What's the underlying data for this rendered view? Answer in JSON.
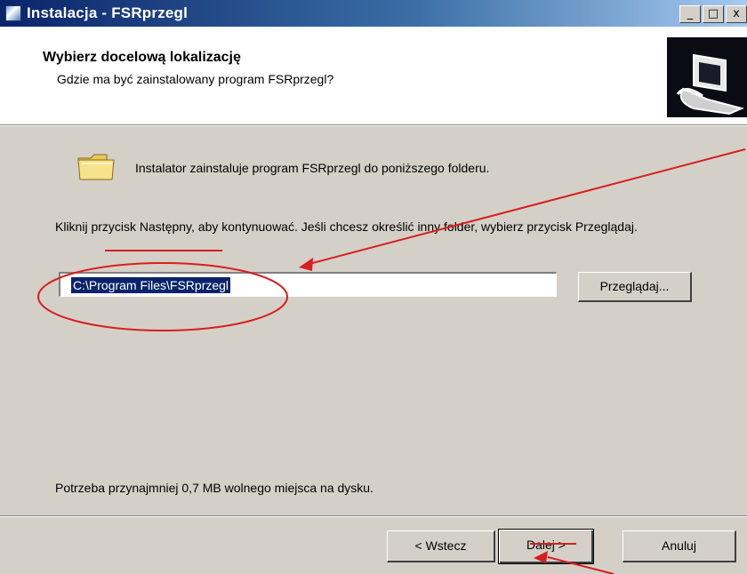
{
  "window": {
    "title": "Instalacja - FSRprzegl",
    "controls": {
      "minimize": "_",
      "maximize": "□",
      "close": "x"
    }
  },
  "header": {
    "title": "Wybierz docelową lokalizację",
    "subtitle": "Gdzie ma być zainstalowany program FSRprzegl?"
  },
  "body": {
    "intro": "Instalator zainstaluje program FSRprzegl do poniższego folderu.",
    "instruction": "Kliknij przycisk Następny, aby kontynuować. Jeśli chcesz określić inny folder, wybierz przycisk Przeglądaj.",
    "path_value": "C:\\Program Files\\FSRprzegl",
    "browse_label": "Przeglądaj...",
    "space_required": "Potrzeba przynajmniej 0,7 MB wolnego miejsca na dysku."
  },
  "footer": {
    "back_label": "< Wstecz",
    "next_label": "Dalej >",
    "cancel_label": "Anuluj"
  },
  "colors": {
    "title_gradient": [
      "#0a246a",
      "#a6caf0"
    ],
    "annotation": "#d81e1e",
    "selection": "#0a246a"
  }
}
